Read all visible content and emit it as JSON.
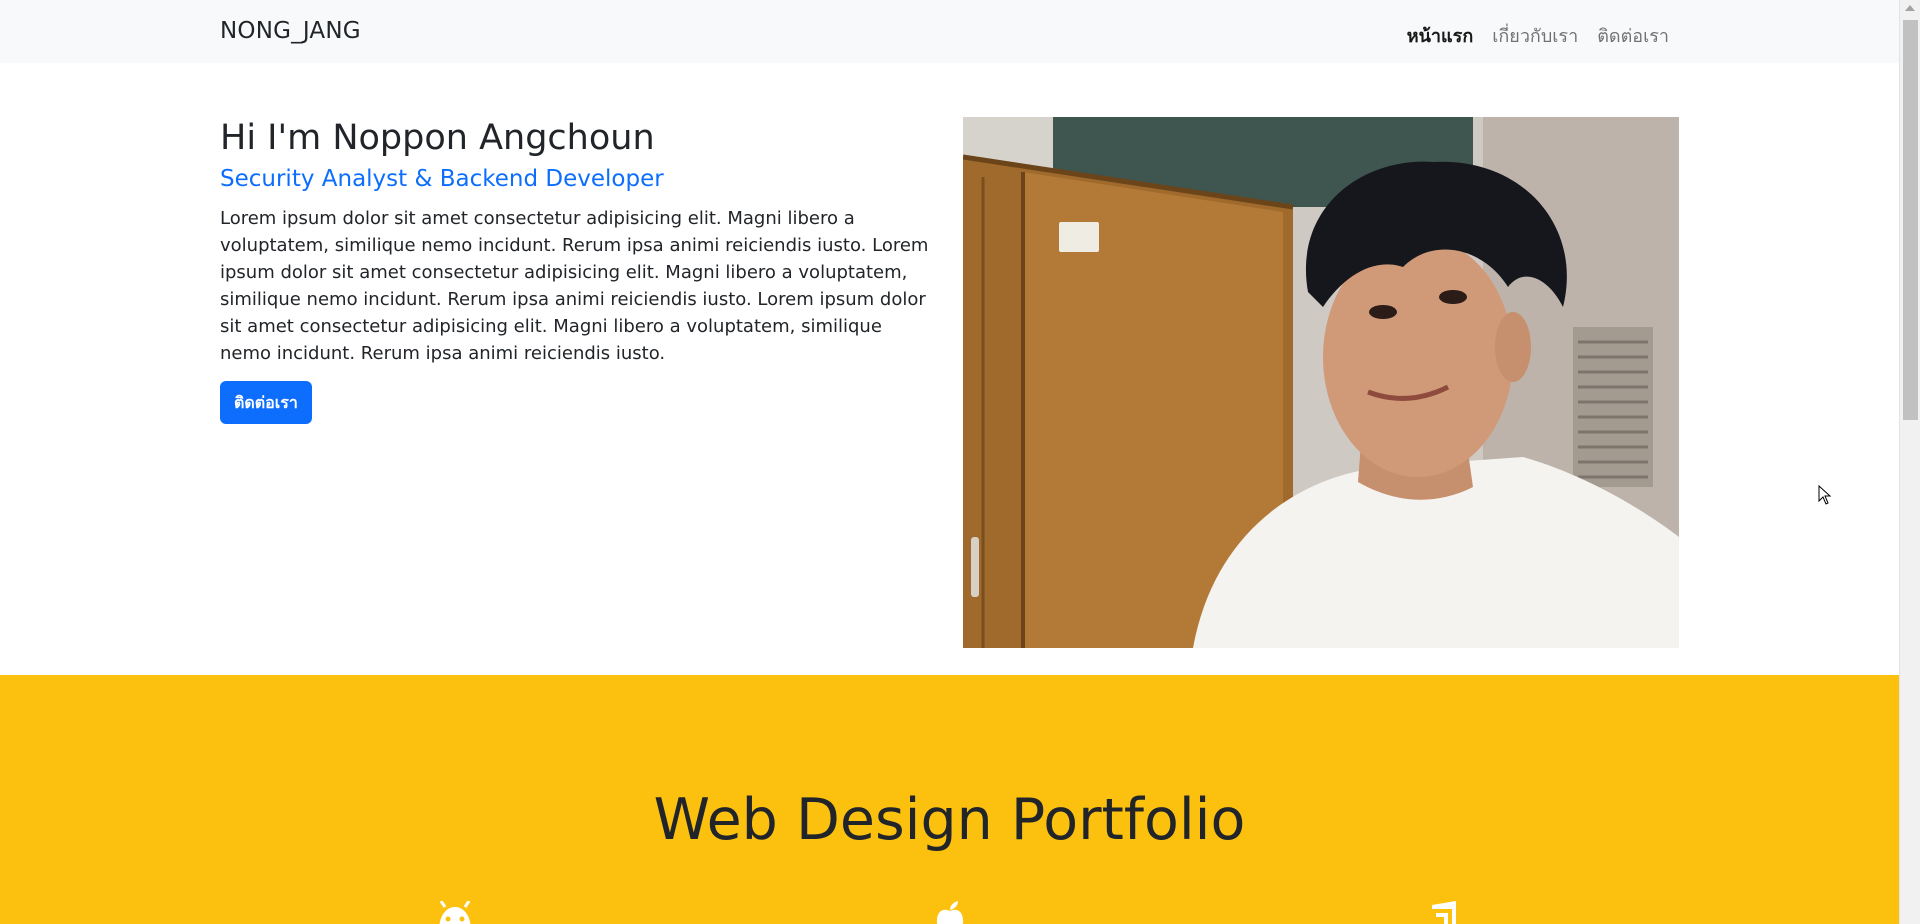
{
  "navbar": {
    "brand": "NONG_JANG",
    "links": [
      {
        "label": "หน้าแรก",
        "active": true
      },
      {
        "label": "เกี่ยวกับเรา",
        "active": false
      },
      {
        "label": "ติดต่อเรา",
        "active": false
      }
    ]
  },
  "hero": {
    "title": "Hi I'm Noppon Angchoun",
    "subtitle": "Security Analyst & Backend Developer",
    "description": "Lorem ipsum dolor sit amet consectetur adipisicing elit. Magni libero a voluptatem, similique nemo incidunt. Rerum ipsa animi reiciendis iusto. Lorem ipsum dolor sit amet consectetur adipisicing elit. Magni libero a voluptatem, similique nemo incidunt. Rerum ipsa animi reiciendis iusto. Lorem ipsum dolor sit amet consectetur adipisicing elit. Magni libero a voluptatem, similique nemo incidunt. Rerum ipsa animi reiciendis iusto.",
    "button_label": "ติดต่อเรา",
    "photo_icon": "profile-photo"
  },
  "portfolio": {
    "title": "Web Design Portfolio",
    "icons": [
      "android-icon",
      "apple-icon",
      "windows-icon"
    ]
  },
  "colors": {
    "navbar_bg": "#f8f9fa",
    "accent_blue": "#0d6efd",
    "portfolio_bg": "#fcc10f"
  }
}
